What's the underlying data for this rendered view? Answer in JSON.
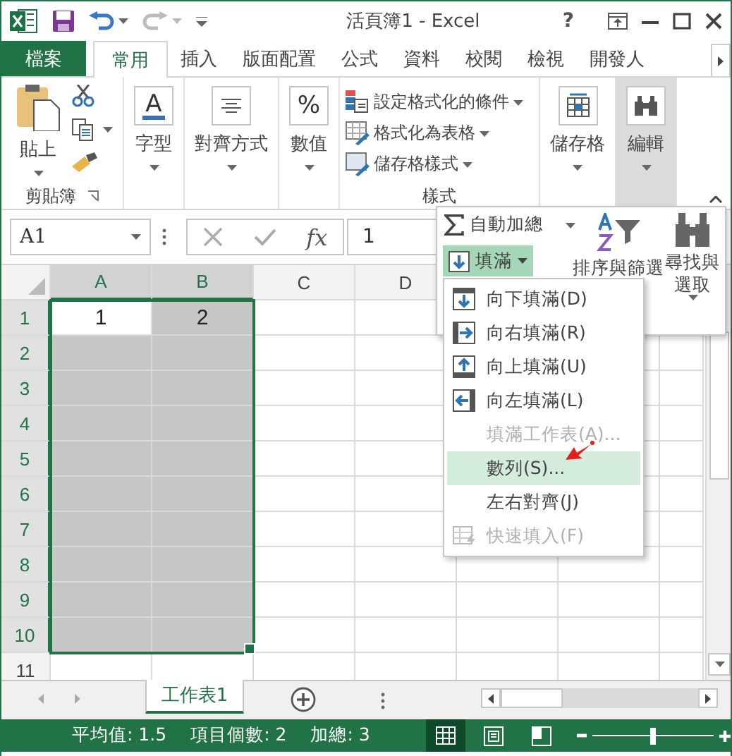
{
  "title_bar": {
    "title": "活頁簿1 - Excel",
    "help": "?"
  },
  "ribbon_tabs": [
    {
      "label": "檔案",
      "kind": "file",
      "selected": false
    },
    {
      "label": "常用",
      "kind": "tab",
      "selected": true
    },
    {
      "label": "插入",
      "kind": "tab",
      "selected": false
    },
    {
      "label": "版面配置",
      "kind": "tab",
      "selected": false
    },
    {
      "label": "公式",
      "kind": "tab",
      "selected": false
    },
    {
      "label": "資料",
      "kind": "tab",
      "selected": false
    },
    {
      "label": "校閱",
      "kind": "tab",
      "selected": false
    },
    {
      "label": "檢視",
      "kind": "tab",
      "selected": false
    },
    {
      "label": "開發人",
      "kind": "tab",
      "selected": false
    }
  ],
  "ribbon_groups": [
    {
      "kind": "clipboard",
      "label": "剪貼簿",
      "paste": "貼上"
    },
    {
      "kind": "font",
      "glyph": "A",
      "button": "字型",
      "pressed": false
    },
    {
      "kind": "align",
      "button": "對齊方式",
      "pressed": false
    },
    {
      "kind": "number",
      "glyph": "%",
      "button": "數值",
      "pressed": false
    },
    {
      "kind": "styles",
      "label": "樣式",
      "items": [
        "設定格式化的條件",
        "格式化為表格",
        "儲存格樣式"
      ]
    },
    {
      "kind": "cells",
      "button": "儲存格",
      "pressed": false
    },
    {
      "kind": "find",
      "button": "編輯",
      "pressed": true
    }
  ],
  "formula_bar": {
    "name_box": "A1",
    "function_glyph": "fx",
    "value": "1"
  },
  "grid": {
    "columns": [
      {
        "label": "A",
        "selected": true
      },
      {
        "label": "B",
        "selected": true
      },
      {
        "label": "C",
        "selected": false
      },
      {
        "label": "D",
        "selected": false
      }
    ],
    "rows": [
      {
        "label": "1",
        "selected": true,
        "cells": [
          "1",
          "2"
        ]
      },
      {
        "label": "2",
        "selected": true
      },
      {
        "label": "3",
        "selected": true
      },
      {
        "label": "4",
        "selected": true
      },
      {
        "label": "5",
        "selected": true
      },
      {
        "label": "6",
        "selected": true
      },
      {
        "label": "7",
        "selected": true
      },
      {
        "label": "8",
        "selected": true
      },
      {
        "label": "9",
        "selected": true
      },
      {
        "label": "10",
        "selected": true
      },
      {
        "label": "11",
        "selected": false
      }
    ]
  },
  "editing_panel": {
    "autosum": "自動加總",
    "fill": {
      "label": "填滿",
      "open": true
    },
    "sort": "排序與篩選",
    "find": "尋找與選取"
  },
  "fill_menu": [
    {
      "label": "向下填滿(D)",
      "kind": "down",
      "disabled": false,
      "selected": false
    },
    {
      "label": "向右填滿(R)",
      "kind": "right",
      "disabled": false,
      "selected": false
    },
    {
      "label": "向上填滿(U)",
      "kind": "up",
      "disabled": false,
      "selected": false
    },
    {
      "label": "向左填滿(L)",
      "kind": "left",
      "disabled": false,
      "selected": false
    },
    {
      "label": "填滿工作表(A)...",
      "kind": "plain",
      "disabled": true,
      "selected": false
    },
    {
      "label": "數列(S)...",
      "kind": "plain",
      "disabled": false,
      "selected": true
    },
    {
      "label": "左右對齊(J)",
      "kind": "plain",
      "disabled": false,
      "selected": false
    },
    {
      "label": "快速填入(F)",
      "kind": "flash",
      "disabled": true,
      "selected": false
    }
  ],
  "sheet_tabs": [
    {
      "label": "工作表1",
      "selected": true
    }
  ],
  "status_bar": {
    "stats": [
      "平均值: 1.5",
      "項目個數: 2",
      "加總: 3"
    ],
    "views": [
      {
        "kind": "normal",
        "selected": true
      },
      {
        "kind": "page_layout",
        "selected": false
      },
      {
        "kind": "page_break",
        "selected": false
      }
    ],
    "zoom": {
      "level": 0.5
    }
  }
}
